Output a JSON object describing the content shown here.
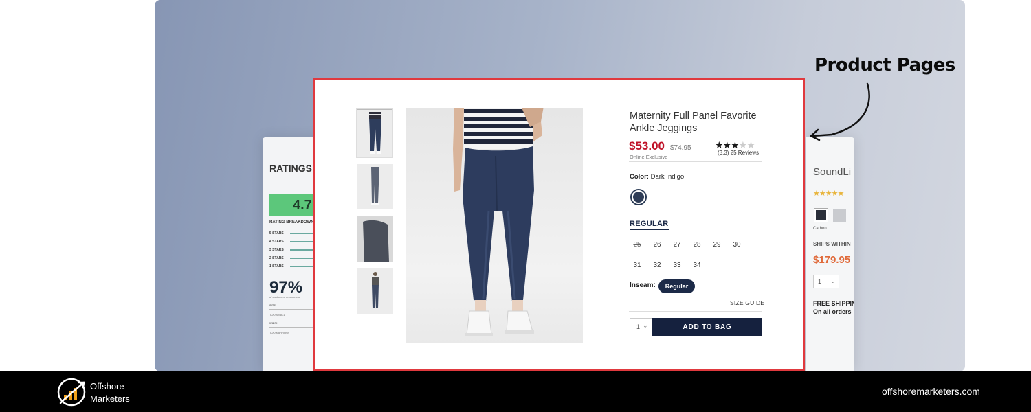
{
  "heading": "Product Pages",
  "left_card": {
    "title": "RATINGS",
    "score": "4.7",
    "breakdown_label": "RATING BREAKDOWN",
    "star_rows": [
      "5 STARS",
      "4 STARS",
      "3 STARS",
      "2 STARS",
      "1 STARS"
    ],
    "percent": "97%",
    "recommend_text": "of customers recommend",
    "size_label": "SIZE",
    "size_value": "TOO SMALL",
    "width_label": "WIDTH",
    "width_value": "TOO NARROW"
  },
  "product": {
    "title": "Maternity Full Panel Favorite Ankle Jeggings",
    "price": "$53.00",
    "original_price": "$74.95",
    "online_exclusive": "Online Exclusive",
    "rating": 3.3,
    "stars": "★★★",
    "stars_empty": "★★",
    "reviews": "(3.3) 25 Reviews",
    "color_label": "Color:",
    "color_value": "Dark Indigo",
    "fit_tab": "REGULAR",
    "sizes_row1": [
      "25",
      "26",
      "27",
      "28",
      "29",
      "30"
    ],
    "sizes_row2": [
      "31",
      "32",
      "33",
      "34"
    ],
    "inseam_label": "Inseam:",
    "inseam_value": "Regular",
    "size_guide": "SIZE GUIDE",
    "quantity": "1",
    "add_to_bag": "ADD TO BAG",
    "colors": {
      "accent": "#15213e",
      "price": "#c0142a",
      "highlight_border": "#e0393e"
    }
  },
  "right_card": {
    "name": "SoundLi",
    "stars": "★★★★★",
    "swatch_label": "Carbon",
    "ships": "SHIPS WITHIN",
    "price": "$179.95",
    "quantity": "1",
    "free_shipping": "FREE SHIPPIN",
    "all_orders": "On all orders"
  },
  "footer": {
    "brand_line1": "Offshore",
    "brand_line2": "Marketers",
    "url": "offshoremarketers.com"
  }
}
